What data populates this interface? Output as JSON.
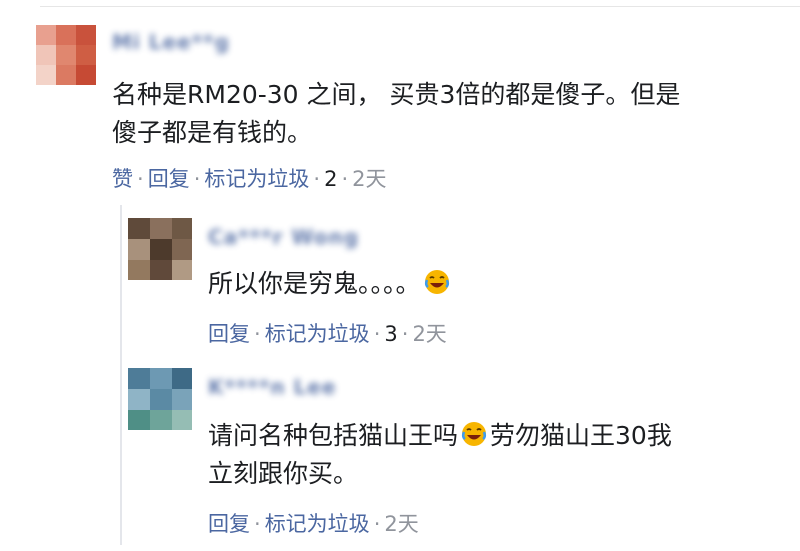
{
  "comments": [
    {
      "author": "Mi Lee**g",
      "text_lines": [
        "名种是RM20-30 之间， 买贵3倍的都是傻子。但是",
        "傻子都是有钱的。"
      ],
      "like_label": "赞",
      "reply_label": "回复",
      "spam_label": "标记为垃圾",
      "reaction_count": "2",
      "time": "2天",
      "avatar_colors": [
        "#e8a08f",
        "#d9715a",
        "#c9523c",
        "#f0c5b8",
        "#e0876f",
        "#cf5e44",
        "#f3d3c8",
        "#db7a62",
        "#c64a34"
      ]
    },
    {
      "author": "Ca***r Wong",
      "text_line_1_before": "所以你是穷鬼。。。。",
      "reply_label": "回复",
      "spam_label": "标记为垃圾",
      "reaction_count": "3",
      "time": "2天",
      "avatar_colors": [
        "#5f4a3a",
        "#8a705d",
        "#6e5845",
        "#a8917c",
        "#4d3a2c",
        "#7f6652",
        "#93795f",
        "#60493a",
        "#b09a84"
      ]
    },
    {
      "author": "K****n Lee",
      "text_line_1_before": "请问名种包括猫山王吗",
      "text_line_1_after": "劳勿猫山王30我",
      "text_line_2": "立刻跟你买。",
      "reply_label": "回复",
      "spam_label": "标记为垃圾",
      "time": "2天",
      "avatar_colors": [
        "#4e7c98",
        "#6d99b3",
        "#3e6a86",
        "#8fb4c6",
        "#5b8aa4",
        "#7aa3b9",
        "#4f8f86",
        "#6ea49a",
        "#95bdb4"
      ]
    }
  ],
  "emoji_name": "laughing-tears-emoji"
}
